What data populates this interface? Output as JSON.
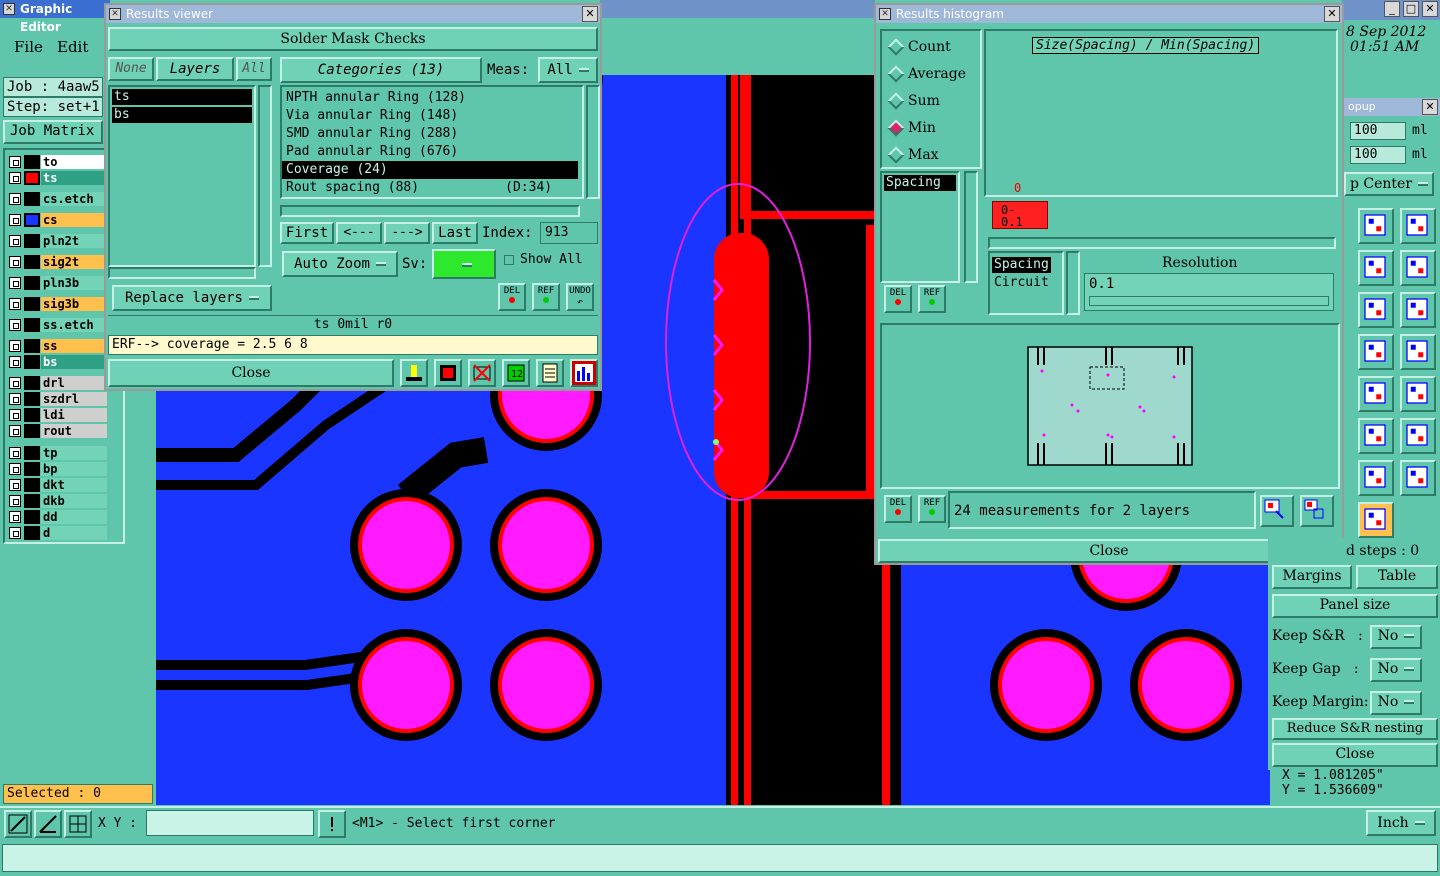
{
  "main": {
    "title": "Graphic Editor",
    "menu": [
      "File",
      "Edit"
    ],
    "job_label": "Job : 4aaw5",
    "step_label": "Step: set+1",
    "job_matrix": "Job Matrix",
    "selected": "Selected : 0",
    "xy_label": "X Y :",
    "prompt": "<M1> - Select first corner",
    "units": "Inch",
    "date": "8 Sep 2012",
    "time": "01:51 AM",
    "coord_x": "X = 1.081205\"",
    "coord_y": "Y = 1.536609\""
  },
  "layers": [
    {
      "name": "to",
      "color": "#ffffff",
      "swatch": "#000000"
    },
    {
      "name": "ts",
      "color": "#2ea084",
      "swatch": "#ff0000"
    },
    {
      "name": "cs.etch",
      "color": "#72d3b6",
      "swatch": "#000000"
    },
    {
      "name": "cs",
      "color": "#ffc04d",
      "swatch": "#1a35ff"
    },
    {
      "name": "pln2t",
      "color": "#72d3b6",
      "swatch": "#000000"
    },
    {
      "name": "sig2t",
      "color": "#ffc04d",
      "swatch": "#000000"
    },
    {
      "name": "pln3b",
      "color": "#72d3b6",
      "swatch": "#000000"
    },
    {
      "name": "sig3b",
      "color": "#ffc04d",
      "swatch": "#000000"
    },
    {
      "name": "ss.etch",
      "color": "#72d3b6",
      "swatch": "#000000"
    },
    {
      "name": "ss",
      "color": "#ffc04d",
      "swatch": "#000000"
    },
    {
      "name": "bs",
      "color": "#2ea084",
      "swatch": "#000000"
    },
    {
      "name": "drl",
      "color": "#cfcfcf",
      "swatch": "#000000"
    },
    {
      "name": "szdrl",
      "color": "#cfcfcf",
      "swatch": "#000000"
    },
    {
      "name": "ldi",
      "color": "#cfcfcf",
      "swatch": "#000000"
    },
    {
      "name": "rout",
      "color": "#cfcfcf",
      "swatch": "#000000"
    },
    {
      "name": "tp",
      "color": "#72d3b6",
      "swatch": "#000000"
    },
    {
      "name": "bp",
      "color": "#72d3b6",
      "swatch": "#000000"
    },
    {
      "name": "dkt",
      "color": "#72d3b6",
      "swatch": "#000000"
    },
    {
      "name": "dkb",
      "color": "#72d3b6",
      "swatch": "#000000"
    },
    {
      "name": "dd",
      "color": "#72d3b6",
      "swatch": "#000000"
    },
    {
      "name": "d",
      "color": "#72d3b6",
      "swatch": "#000000"
    }
  ],
  "viewer": {
    "title": "Results viewer",
    "header": "Solder Mask Checks",
    "none_btn": "None",
    "layers_btn": "Layers",
    "all_btn": "All",
    "categories_btn": "Categories (13)",
    "meas_label": "Meas:",
    "meas_value": "All",
    "layer_list": [
      "ts",
      "bs"
    ],
    "categories": [
      "NPTH annular Ring (128)",
      "Via annular Ring (148)",
      "SMD annular Ring (288)",
      "Pad annular Ring (676)",
      "Coverage (24)",
      "Rout spacing (88)           (D:34)"
    ],
    "first": "First",
    "prev": "<---",
    "next": "--->",
    "last": "Last",
    "index_label": "Index:",
    "index_value": "913",
    "auto_zoom": "Auto Zoom",
    "sv_label": "Sv:",
    "show_all": "Show All",
    "del": "DEL",
    "ref": "REF",
    "undo": "UNDO",
    "replace_layers": "Replace layers",
    "status": "ts 0mil  r0",
    "erf": "ERF--> coverage = 2.5 6 8",
    "close": "Close"
  },
  "histogram": {
    "title": "Results histogram",
    "options": [
      "Count",
      "Average",
      "Sum",
      "Min",
      "Max"
    ],
    "selected_option": "Min",
    "chart_title": "Size(Spacing) / Min(Spacing)",
    "measure_list": [
      "Spacing"
    ],
    "bar_count": "0",
    "bar_range": "0-\n0.1",
    "res_list": [
      "Spacing",
      "Circuit"
    ],
    "resolution_label": "Resolution",
    "resolution_value": "0.1",
    "del": "DEL",
    "ref": "REF",
    "summary": "24 measurements for 2 layers",
    "close": "Close"
  },
  "popup": {
    "title": "opup",
    "field1": "100",
    "unit1": "ml",
    "field2": "100",
    "unit2": "ml",
    "center": "p Center",
    "steps": "d steps : 0",
    "margins": "Margins",
    "table": "Table",
    "panel_size": "Panel size",
    "keep_sr_label": "Keep S&R   :",
    "keep_sr": "No",
    "keep_gap_label": "Keep Gap   :",
    "keep_gap": "No",
    "keep_margin_label": "Keep Margin:",
    "keep_margin": "No",
    "reduce": "Reduce S&R nesting",
    "close": "Close"
  },
  "colors": {
    "panel": "#5fc6ab",
    "board_blue": "#1a35ff",
    "pad_magenta": "#ff1aff",
    "copper_red": "#ff0000",
    "highlight": "#e020e0"
  }
}
